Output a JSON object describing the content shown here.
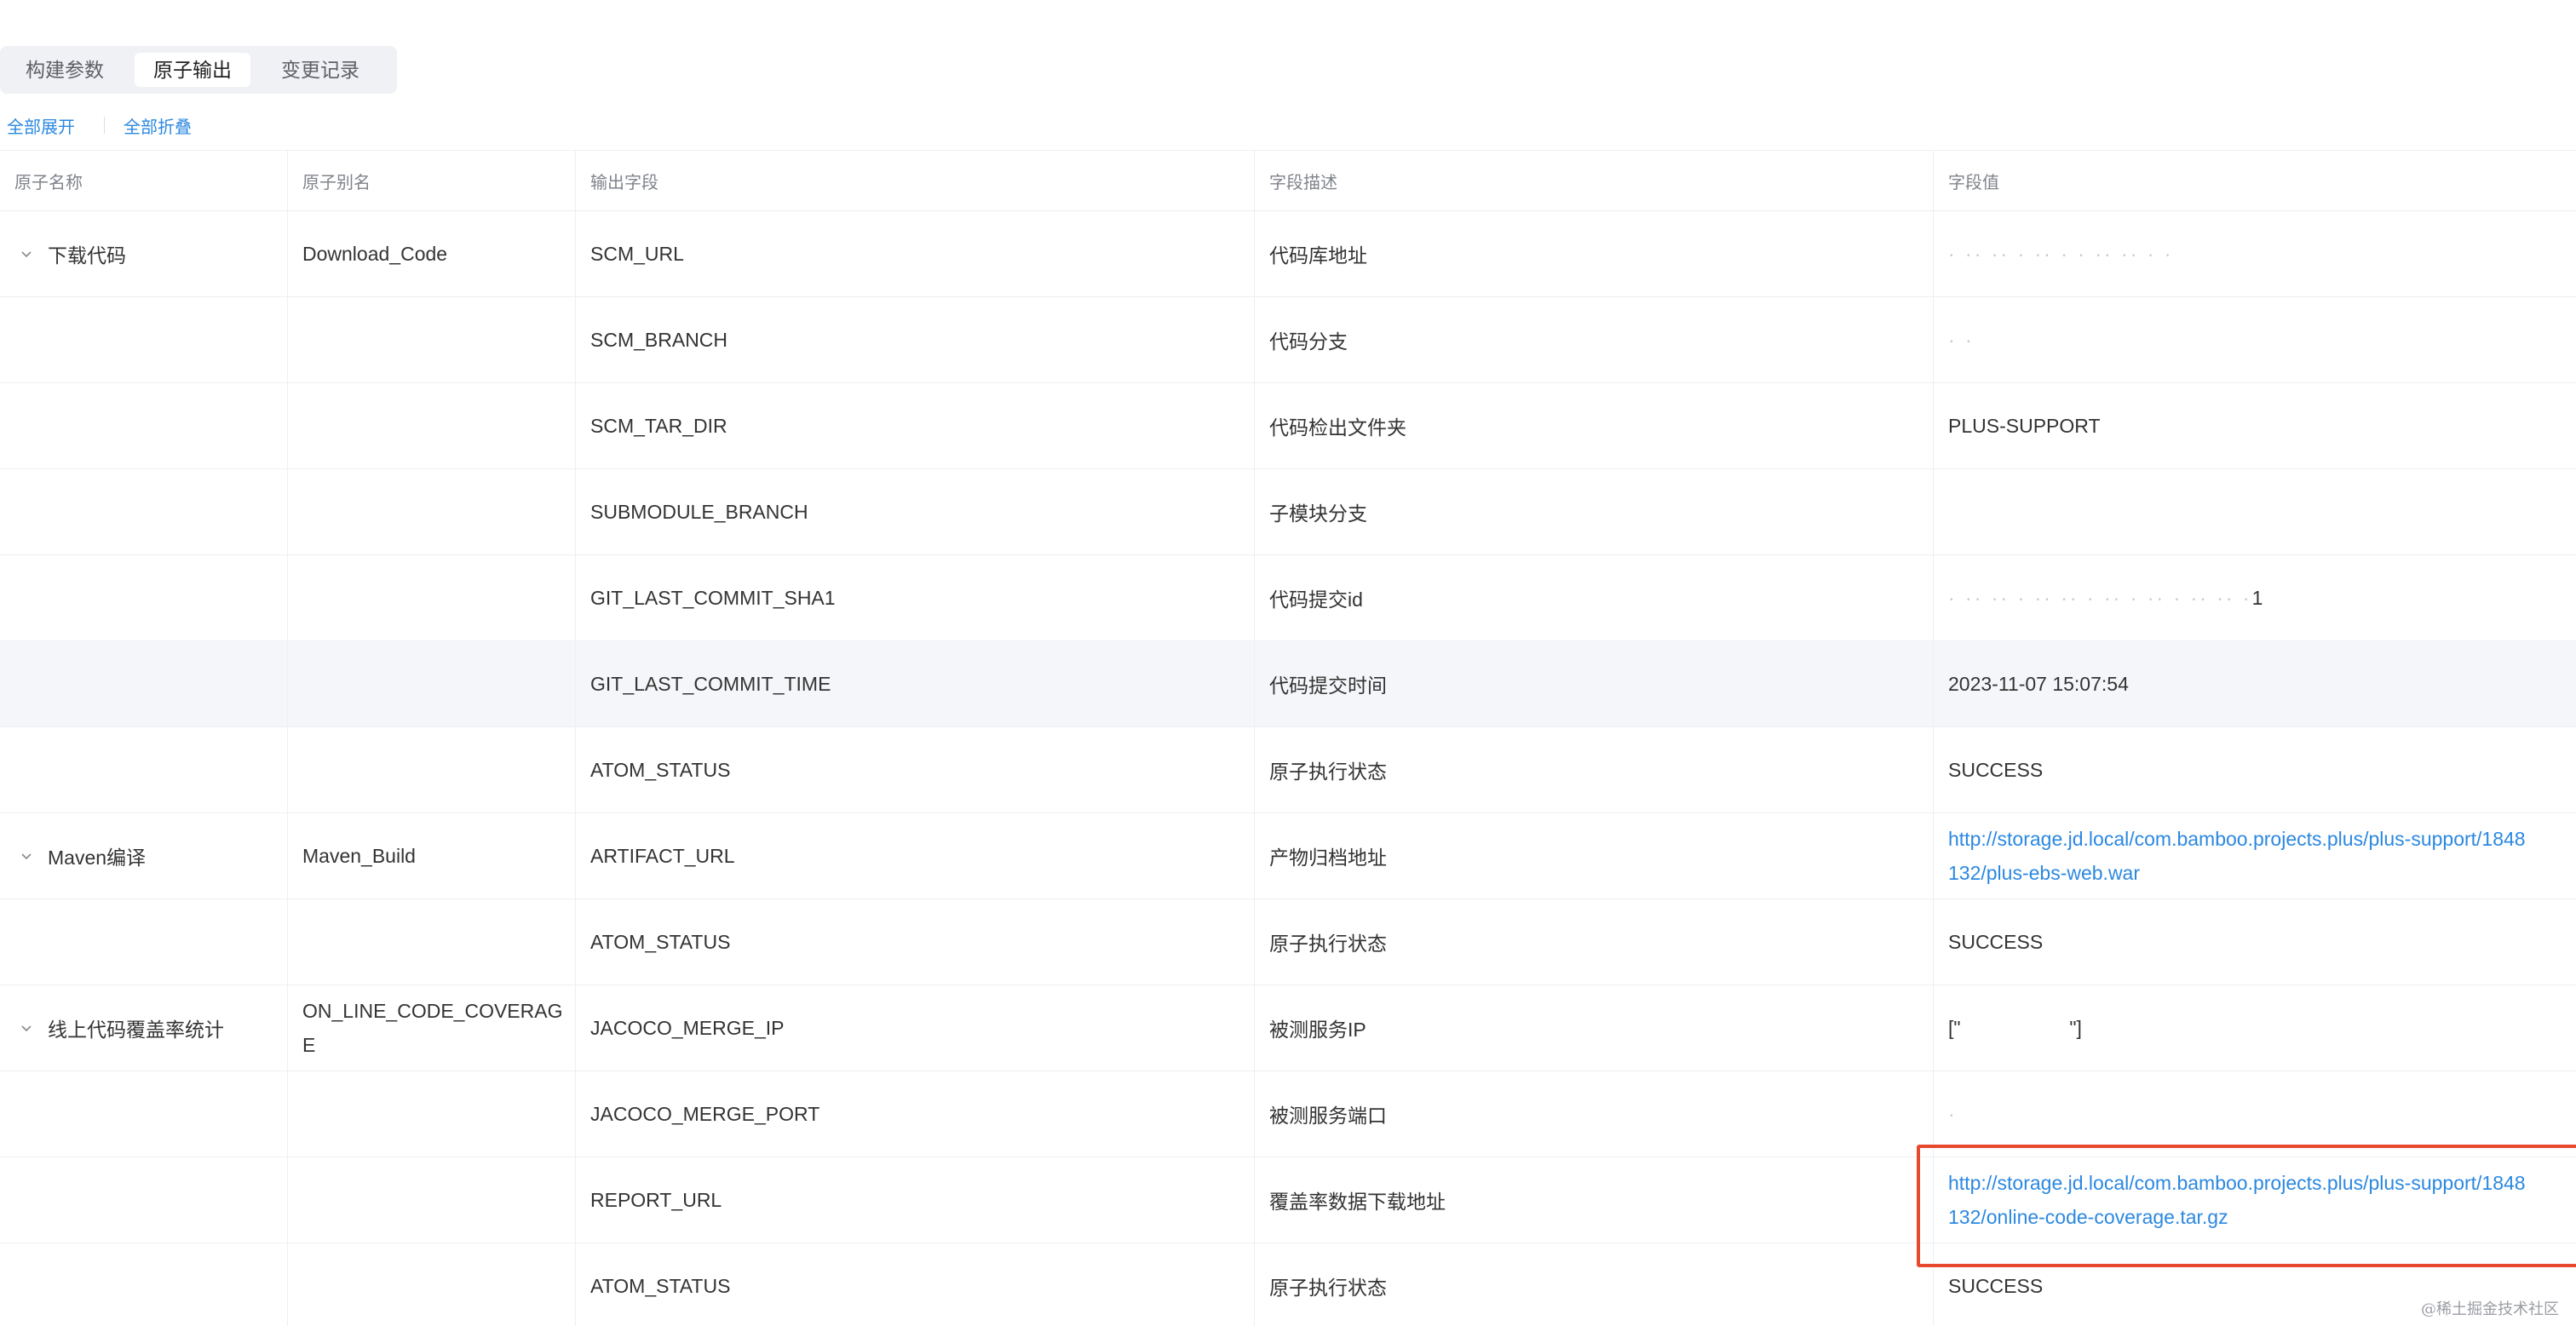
{
  "tabs": [
    {
      "label": "构建参数",
      "active": false
    },
    {
      "label": "原子输出",
      "active": true
    },
    {
      "label": "变更记录",
      "active": false
    }
  ],
  "toolbar": {
    "expand_all": "全部展开",
    "collapse_all": "全部折叠"
  },
  "table": {
    "columns": [
      "原子名称",
      "原子别名",
      "输出字段",
      "字段描述",
      "字段值"
    ],
    "rows": [
      {
        "name": "下载代码",
        "alias": "Download_Code",
        "field": "SCM_URL",
        "desc": "代码库地址",
        "value": "",
        "expandable": true
      },
      {
        "name": "",
        "alias": "",
        "field": "SCM_BRANCH",
        "desc": "代码分支",
        "value": ""
      },
      {
        "name": "",
        "alias": "",
        "field": "SCM_TAR_DIR",
        "desc": "代码检出文件夹",
        "value": "PLUS-SUPPORT"
      },
      {
        "name": "",
        "alias": "",
        "field": "SUBMODULE_BRANCH",
        "desc": "子模块分支",
        "value": ""
      },
      {
        "name": "",
        "alias": "",
        "field": "GIT_LAST_COMMIT_SHA1",
        "desc": "代码提交id",
        "value": "1"
      },
      {
        "name": "",
        "alias": "",
        "field": "GIT_LAST_COMMIT_TIME",
        "desc": "代码提交时间",
        "value": "2023-11-07 15:07:54"
      },
      {
        "name": "",
        "alias": "",
        "field": "ATOM_STATUS",
        "desc": "原子执行状态",
        "value": "SUCCESS"
      },
      {
        "name": "Maven编译",
        "alias": "Maven_Build",
        "field": "ARTIFACT_URL",
        "desc": "产物归档地址",
        "value_line1": "http://storage.jd.local/com.bamboo.projects.plus/plus-support/1848",
        "value_line2": "132/plus-ebs-web.war",
        "expandable": true
      },
      {
        "name": "",
        "alias": "",
        "field": "ATOM_STATUS",
        "desc": "原子执行状态",
        "value": "SUCCESS"
      },
      {
        "name": "线上代码覆盖率统计",
        "alias": "ON_LINE_CODE_COVERAGE",
        "field": "JACOCO_MERGE_IP",
        "desc": "被测服务IP",
        "value": "[\"                    \"]",
        "expandable": true
      },
      {
        "name": "",
        "alias": "",
        "field": "JACOCO_MERGE_PORT",
        "desc": "被测服务端口",
        "value": ""
      },
      {
        "name": "",
        "alias": "",
        "field": "REPORT_URL",
        "desc": "覆盖率数据下载地址",
        "value_line1": "http://storage.jd.local/com.bamboo.projects.plus/plus-support/1848",
        "value_line2": "132/online-code-coverage.tar.gz"
      },
      {
        "name": "",
        "alias": "",
        "field": "ATOM_STATUS",
        "desc": "原子执行状态",
        "value": "SUCCESS"
      }
    ]
  },
  "watermark": "@稀土掘金技术社区",
  "colors": {
    "link": "#2b88e0",
    "highlight": "#e8482e",
    "row_hover": "#f5f6f9"
  }
}
